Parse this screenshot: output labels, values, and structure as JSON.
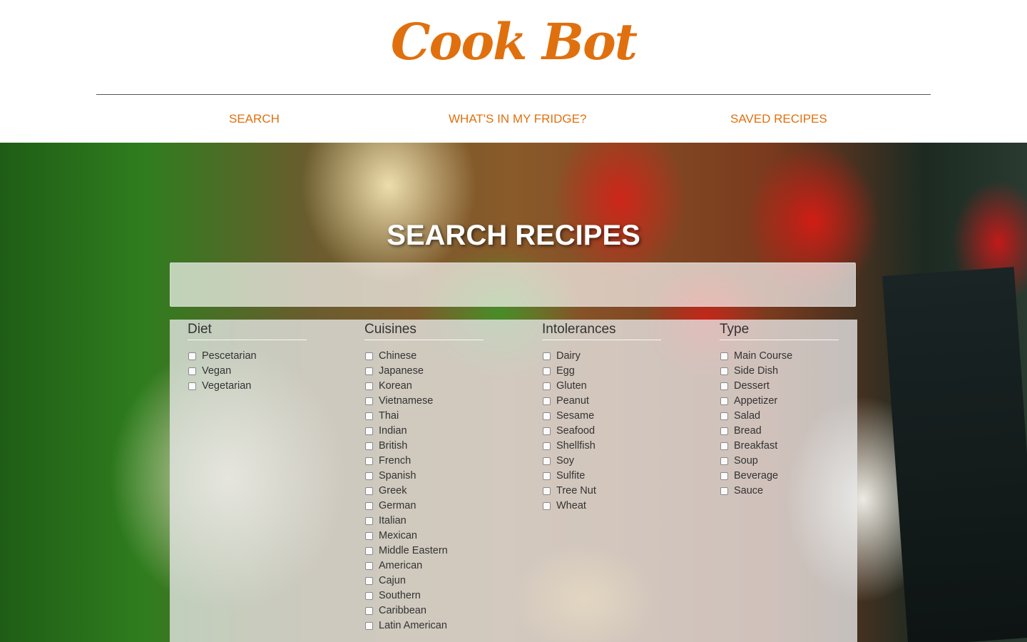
{
  "app": {
    "logo": "Cook Bot"
  },
  "nav": {
    "search": "SEARCH",
    "fridge": "WHAT'S IN MY FRIDGE?",
    "saved": "SAVED RECIPES"
  },
  "colors": {
    "accent": "#e0700e",
    "text": "#333333"
  },
  "search": {
    "title": "SEARCH RECIPES",
    "value": "",
    "placeholder": ""
  },
  "filters": [
    {
      "name": "Diet",
      "options": [
        "Pescetarian",
        "Vegan",
        "Vegetarian"
      ]
    },
    {
      "name": "Cuisines",
      "options": [
        "Chinese",
        "Japanese",
        "Korean",
        "Vietnamese",
        "Thai",
        "Indian",
        "British",
        "French",
        "Spanish",
        "Greek",
        "German",
        "Italian",
        "Mexican",
        "Middle Eastern",
        "American",
        "Cajun",
        "Southern",
        "Caribbean",
        "Latin American"
      ]
    },
    {
      "name": "Intolerances",
      "options": [
        "Dairy",
        "Egg",
        "Gluten",
        "Peanut",
        "Sesame",
        "Seafood",
        "Shellfish",
        "Soy",
        "Sulfite",
        "Tree Nut",
        "Wheat"
      ]
    },
    {
      "name": "Type",
      "options": [
        "Main Course",
        "Side Dish",
        "Dessert",
        "Appetizer",
        "Salad",
        "Bread",
        "Breakfast",
        "Soup",
        "Beverage",
        "Sauce"
      ]
    }
  ]
}
